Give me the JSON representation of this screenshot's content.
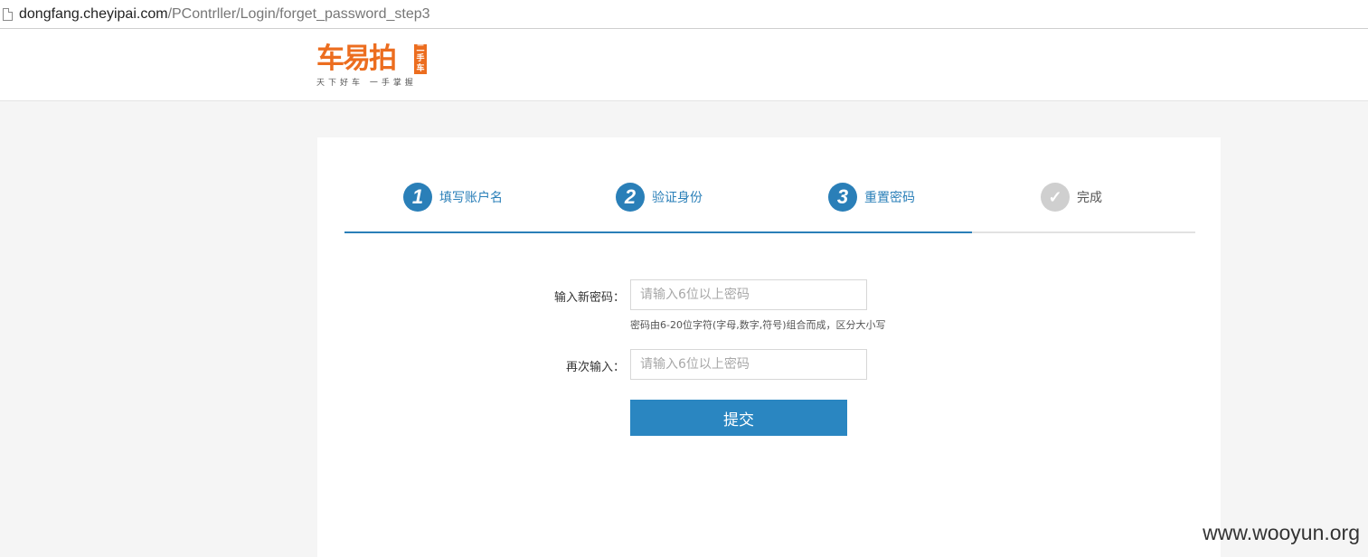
{
  "browser": {
    "url_host": "dongfang.cheyipai.com",
    "url_path": "/PContrller/Login/forget_password_step3"
  },
  "header": {
    "logo_text": "车易拍",
    "logo_badge": "二手车",
    "logo_slogan": "天下好车 一手掌握"
  },
  "steps": [
    {
      "number": "1",
      "label": "填写账户名"
    },
    {
      "number": "2",
      "label": "验证身份"
    },
    {
      "number": "3",
      "label": "重置密码"
    },
    {
      "number": "✓",
      "label": "完成"
    }
  ],
  "progress": {
    "completed_steps": 3,
    "total_steps": 4
  },
  "form": {
    "new_password": {
      "label": "输入新密码：",
      "placeholder": "请输入6位以上密码",
      "value": "",
      "hint": "密码由6-20位字符(字母,数字,符号)组合而成，区分大小写"
    },
    "confirm_password": {
      "label": "再次输入：",
      "placeholder": "请输入6位以上密码",
      "value": ""
    },
    "submit_label": "提交"
  },
  "watermark": "www.wooyun.org",
  "colors": {
    "accent": "#2a7fb8",
    "brand": "#ec6d1f",
    "inactive": "#cfcfcf"
  }
}
